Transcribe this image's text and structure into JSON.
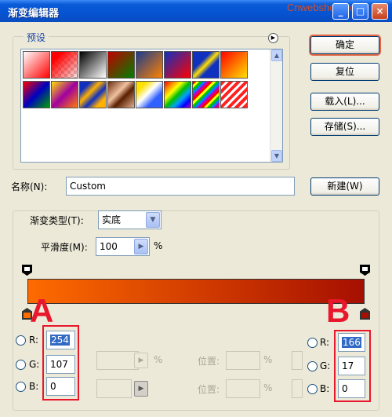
{
  "window": {
    "title": "渐变编辑器",
    "watermark": "Cnwebshow.com",
    "min": "_",
    "max": "□",
    "close": "×"
  },
  "buttons": {
    "ok": "确定",
    "reset": "复位",
    "load": "载入(L)...",
    "save": "存储(S)...",
    "new": "新建(W)"
  },
  "presets": {
    "legend": "预设",
    "menu_icon": "right-arrow-circle-icon",
    "scroll_up": "▲",
    "scroll_down": "▼"
  },
  "name": {
    "label": "名称(N):",
    "value": "Custom"
  },
  "gradient": {
    "type_label": "渐变类型(T):",
    "type_value": "实底",
    "smooth_label": "平滑度(M):",
    "smooth_value": "100",
    "smooth_unit": "%",
    "colors": {
      "start": "#fe6b00",
      "end": "#a60f00"
    }
  },
  "left_color": {
    "r_label": "R:",
    "g_label": "G:",
    "b_label": "B:",
    "r": "254",
    "g": "107",
    "b": "0"
  },
  "right_color": {
    "r_label": "R:",
    "g_label": "G:",
    "b_label": "B:",
    "r": "166",
    "g": "17",
    "b": "0"
  },
  "stops": {
    "position_label_1": "位置:",
    "position_label_2": "位置:",
    "percent_1": "%",
    "percent_2": "%",
    "percent_3": "%",
    "percent_4": "%"
  },
  "annotations": {
    "a": "A",
    "b": "B"
  }
}
